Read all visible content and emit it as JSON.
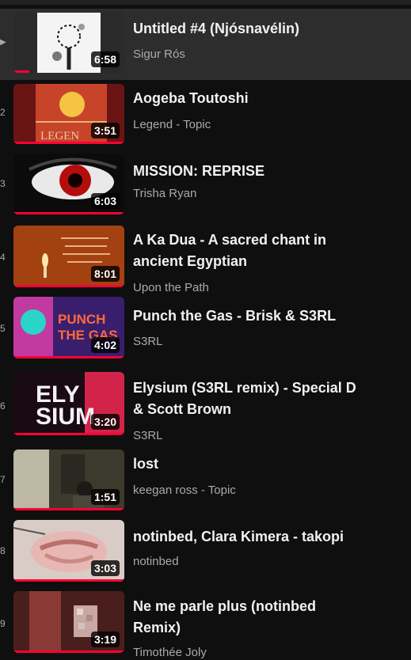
{
  "playlist": {
    "items": [
      {
        "index": "",
        "title": "Untitled #4 (Njósnavélin)",
        "channel": "Sigur Rós",
        "duration": "6:58"
      },
      {
        "index": "2",
        "title": "Aogeba Toutoshi",
        "channel": "Legend - Topic",
        "duration": "3:51",
        "thumb_text": "LEGEN"
      },
      {
        "index": "3",
        "title": "MISSION: REPRISE",
        "channel": "Trisha Ryan",
        "duration": "6:03"
      },
      {
        "index": "4",
        "title": "A Ka Dua - A sacred chant in ancient Egyptian",
        "channel": "Upon the Path",
        "duration": "8:01"
      },
      {
        "index": "5",
        "title": "Punch the Gas - Brisk & S3RL",
        "channel": "S3RL",
        "duration": "4:02",
        "thumb_text": "PUNCH THE GAS"
      },
      {
        "index": "6",
        "title": "Elysium (S3RL remix) - Special D & Scott Brown",
        "channel": "S3RL",
        "duration": "3:20",
        "thumb_text": "ELY SIUM"
      },
      {
        "index": "7",
        "title": "lost",
        "channel": "keegan ross - Topic",
        "duration": "1:51"
      },
      {
        "index": "8",
        "title": "notinbed, Clara Kimera - takopi",
        "channel": "notinbed",
        "duration": "3:03"
      },
      {
        "index": "9",
        "title": "Ne me parle plus (notinbed Remix)",
        "channel": "Timothée Joly",
        "duration": "3:19"
      }
    ]
  },
  "colors": {
    "accent": "#ff0033",
    "background": "#0f0f0f",
    "active_row": "#2d2d2d"
  }
}
